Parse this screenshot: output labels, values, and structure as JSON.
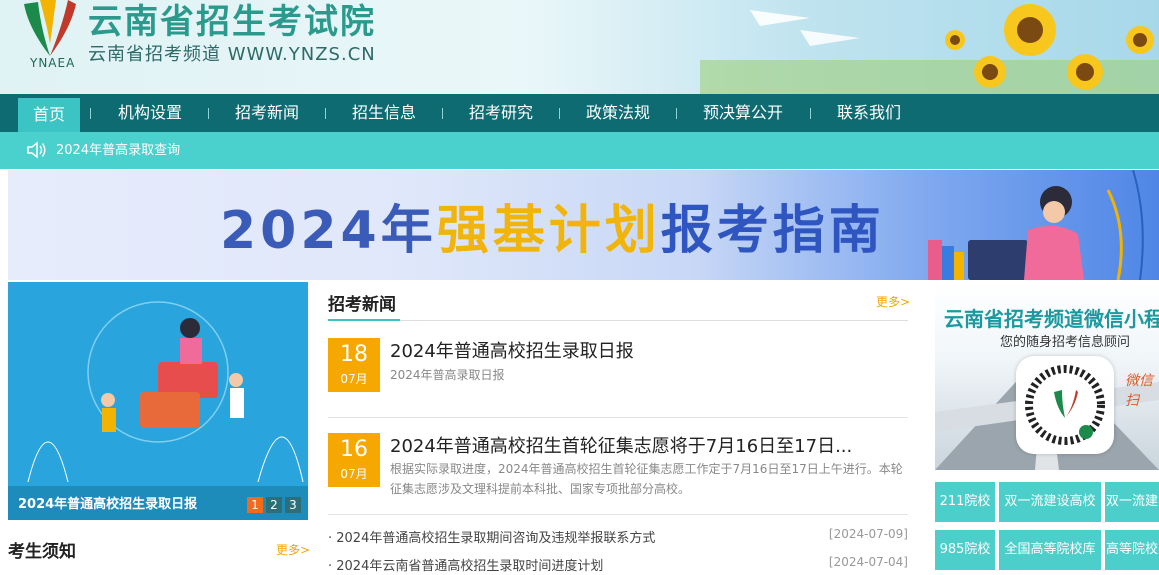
{
  "header": {
    "site_title": "云南省招生考试院",
    "site_subtitle": "云南省招考频道 WWW.YNZS.CN",
    "logo_abbr": "YNAEA"
  },
  "nav": {
    "items": [
      {
        "label": "首页",
        "active": true
      },
      {
        "label": "机构设置"
      },
      {
        "label": "招考新闻"
      },
      {
        "label": "招生信息"
      },
      {
        "label": "招考研究"
      },
      {
        "label": "政策法规"
      },
      {
        "label": "预决算公开"
      },
      {
        "label": "联系我们"
      }
    ]
  },
  "notice": {
    "text": "2024年普高录取查询"
  },
  "banner": {
    "part1": "2024年",
    "part2": "强基计划",
    "part3": "报考指南"
  },
  "slideshow": {
    "caption": "2024年普通高校招生录取日报",
    "pages": [
      "1",
      "2",
      "3"
    ],
    "active_page": 1
  },
  "exam_notes": {
    "title": "考生须知",
    "more": "更多>"
  },
  "news": {
    "title": "招考新闻",
    "more": "更多>",
    "featured": [
      {
        "day": "18",
        "month": "07月",
        "headline": "2024年普通高校招生录取日报",
        "desc": "2024年普高录取日报"
      },
      {
        "day": "16",
        "month": "07月",
        "headline": "2024年普通高校招生首轮征集志愿将于7月16日至17日...",
        "desc": "根据实际录取进度，2024年普通高校招生首轮征集志愿工作定于7月16日至17日上午进行。本轮征集志愿涉及文理科提前本科批、国家专项批部分高校。"
      }
    ],
    "list": [
      {
        "text": "· 2024年普通高校招生录取期间咨询及违规举报联系方式",
        "date": "[2024-07-09]"
      },
      {
        "text": "· 2024年云南省普通高校招生录取时间进度计划",
        "date": "[2024-07-04]"
      }
    ]
  },
  "wechat": {
    "title": "云南省招考频道微信小程",
    "subtitle": "您的随身招考信息顾问",
    "side_text": "微信扫"
  },
  "quick_links": [
    {
      "label": "211院校"
    },
    {
      "label": "双一流建设高校"
    },
    {
      "label": "双一流建"
    },
    {
      "label": "985院校"
    },
    {
      "label": "全国高等院校库"
    },
    {
      "label": "高等院校"
    }
  ]
}
